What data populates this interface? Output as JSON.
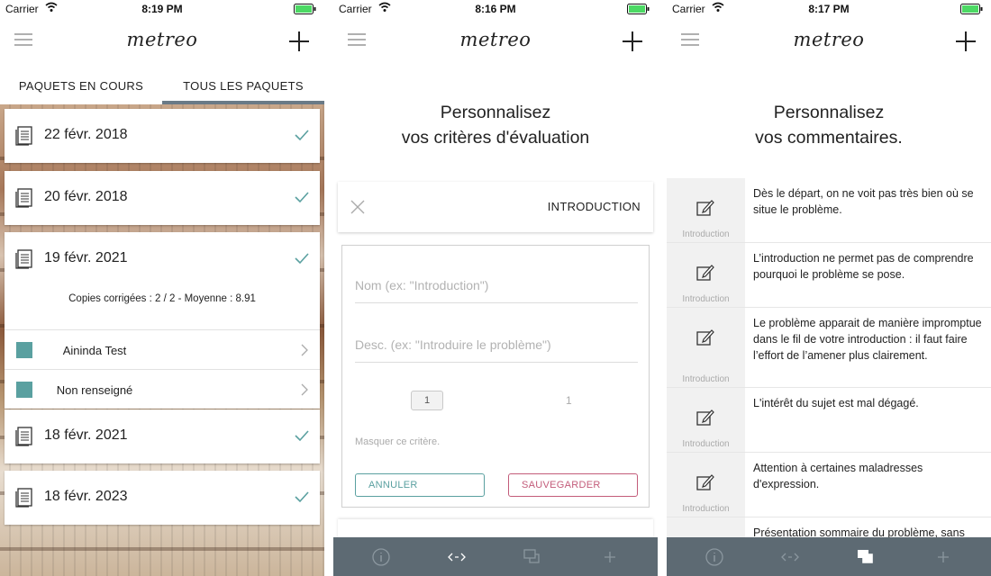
{
  "screens": [
    {
      "status": {
        "carrier": "Carrier",
        "time": "8:19 PM"
      },
      "nav": {
        "logo": "metreo"
      },
      "tabs": [
        "PAQUETS EN COURS",
        "TOUS LES PAQUETS"
      ],
      "active_tab": 1,
      "packages": [
        {
          "date": "22 févr. 2018"
        },
        {
          "date": "20 févr. 2018"
        },
        {
          "date": "19 févr. 2021",
          "stats": "Copies corrigées : 2 / 2 -  Moyenne : 8.91",
          "students": [
            {
              "name": "Aininda Test"
            },
            {
              "name": "Non renseigné"
            }
          ]
        },
        {
          "date": "18 févr. 2021"
        },
        {
          "date": "18 févr. 2023"
        }
      ]
    },
    {
      "status": {
        "carrier": "Carrier",
        "time": "8:16 PM"
      },
      "nav": {
        "logo": "metreo"
      },
      "heading": [
        "Personnalisez",
        "vos critères d'évaluation"
      ],
      "criterion": {
        "title": "INTRODUCTION",
        "name_placeholder": "Nom (ex: \"Introduction\")",
        "desc_placeholder": "Desc. (ex: \"Introduire le problème\")",
        "stepper_value": "1",
        "max_value": "1",
        "hide_label": "Masquer ce critère.",
        "cancel_label": "ANNULER",
        "save_label": "SAUVEGARDER"
      }
    },
    {
      "status": {
        "carrier": "Carrier",
        "time": "8:17 PM"
      },
      "nav": {
        "logo": "metreo"
      },
      "heading": [
        "Personnalisez",
        "vos commentaires."
      ],
      "comments": [
        {
          "category": "Introduction",
          "text": "Dès le départ, on ne voit pas très bien où se situe le problème."
        },
        {
          "category": "Introduction",
          "text": "L’introduction ne permet pas de comprendre pourquoi le problème se pose."
        },
        {
          "category": "Introduction",
          "text": "Le problème apparait de manière impromptue dans le fil de votre introduction : il faut faire l’effort de l’amener plus clairement."
        },
        {
          "category": "Introduction",
          "text": "L'intérêt du sujet est mal dégagé."
        },
        {
          "category": "Introduction",
          "text": "Attention à certaines maladresses d'expression."
        },
        {
          "category": "",
          "text": "Présentation sommaire du problème, sans"
        }
      ]
    }
  ],
  "colors": {
    "teal": "#5aa0a0",
    "rose": "#c35c7a",
    "toolbar": "#5d6a73",
    "active_tab_underline": "#6a7a86"
  },
  "icons": {
    "toolbar": [
      "info-icon",
      "code-arrows-icon",
      "comments-icon",
      "plus-icon"
    ]
  }
}
